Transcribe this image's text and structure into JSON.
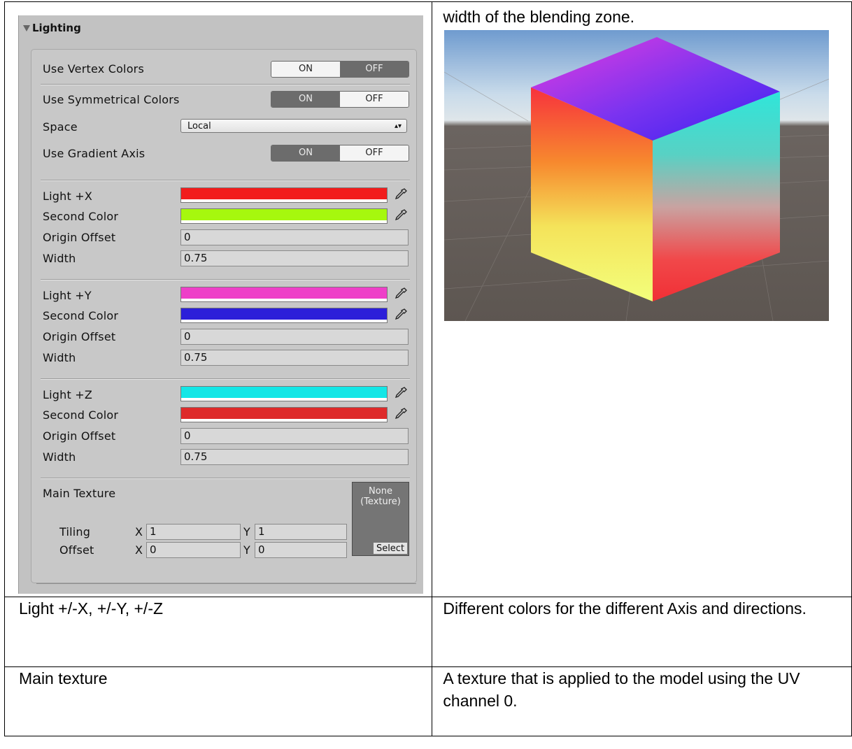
{
  "panel": {
    "header": "Lighting",
    "use_vertex_colors": {
      "label": "Use Vertex Colors",
      "on": "ON",
      "off": "OFF"
    },
    "use_symmetrical_colors": {
      "label": "Use Symmetrical Colors",
      "on": "ON",
      "off": "OFF"
    },
    "space": {
      "label": "Space",
      "value": "Local"
    },
    "use_gradient_axis": {
      "label": "Use Gradient Axis",
      "on": "ON",
      "off": "OFF"
    },
    "groups": [
      {
        "light_label": "Light +X",
        "light_color": "#f21c1c",
        "second_label": "Second Color",
        "second_color": "#a6f80e",
        "offset_label": "Origin Offset",
        "offset_value": "0",
        "width_label": "Width",
        "width_value": "0.75"
      },
      {
        "light_label": "Light +Y",
        "light_color": "#ee3fc8",
        "second_label": "Second Color",
        "second_color": "#2c1fd9",
        "offset_label": "Origin Offset",
        "offset_value": "0",
        "width_label": "Width",
        "width_value": "0.75"
      },
      {
        "light_label": "Light +Z",
        "light_color": "#13e6e6",
        "second_label": "Second Color",
        "second_color": "#de2a2a",
        "offset_label": "Origin Offset",
        "offset_value": "0",
        "width_label": "Width",
        "width_value": "0.75"
      }
    ],
    "main_texture": {
      "label": "Main Texture",
      "tiling_label": "Tiling",
      "offset_label": "Offset",
      "x_label": "X",
      "y_label": "Y",
      "tiling_x": "1",
      "tiling_y": "1",
      "offset_x": "0",
      "offset_y": "0",
      "slot_text_1": "None",
      "slot_text_2": "(Texture)",
      "select_label": "Select"
    }
  },
  "right_caption": "width of the blending zone.",
  "rows": [
    {
      "name": "Light +/-X, +/-Y, +/-Z",
      "description": "Different colors for the different Axis and directions."
    },
    {
      "name": "Main texture",
      "description": "A texture that is applied to the model using the UV channel 0."
    }
  ]
}
